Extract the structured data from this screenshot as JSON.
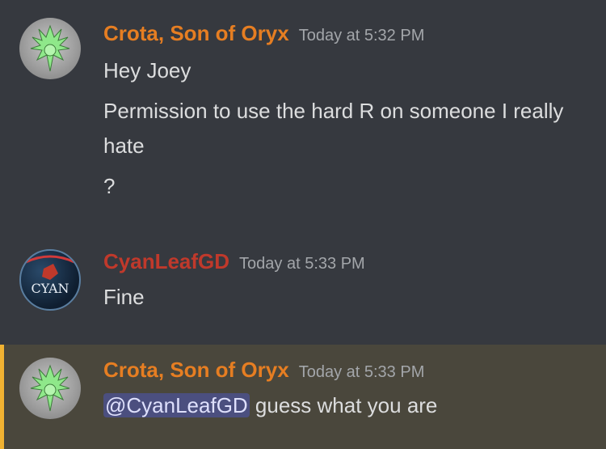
{
  "messages": [
    {
      "username": "Crota, Son of Oryx",
      "timestamp": "Today at 5:32 PM",
      "username_color": "#e67e22",
      "avatar_icon": "green-spiky-character-icon",
      "lines": [
        "Hey Joey",
        "Permission to use the hard R on someone I really hate",
        "?"
      ]
    },
    {
      "username": "CyanLeafGD",
      "timestamp": "Today at 5:33 PM",
      "username_color": "#c0392b",
      "avatar_icon": "cyan-logo-icon",
      "lines": [
        "Fine"
      ]
    },
    {
      "username": "Crota, Son of Oryx",
      "timestamp": "Today at 5:33 PM",
      "username_color": "#e67e22",
      "avatar_icon": "green-spiky-character-icon",
      "mention": "@CyanLeafGD",
      "lines": [
        " guess what you are"
      ]
    }
  ],
  "colors": {
    "background": "#36393f",
    "highlight_bg": "#4a473c",
    "highlight_border": "#f0b232",
    "mention_bg": "#4b4f7f"
  }
}
